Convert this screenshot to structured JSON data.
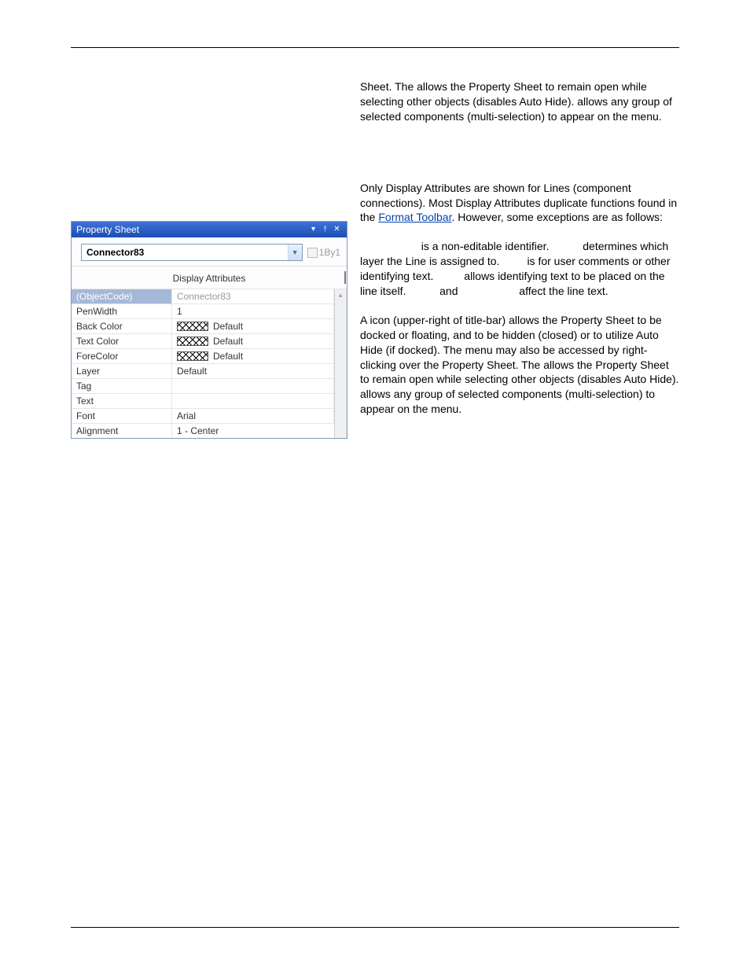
{
  "external_para1": "Sheet. The                       allows the Property Sheet to remain open while selecting other objects (disables Auto Hide).           allows any group of selected components (multi-selection) to appear on the menu.",
  "para_intro_a": "Only Display Attributes are shown for Lines (component connections). Most Display Attributes duplicate functions found in the ",
  "format_toolbar": "Format Toolbar",
  "para_intro_b": ". However, some exceptions are as follows:",
  "bullets": "                    is a non-editable identifier.           determines which layer the Line is assigned to.         is for user comments or other identifying text.          allows identifying text to be placed on the line itself.           and                    affect the line text.",
  "menu_para": "A           icon (upper-right of title-bar) allows the Property Sheet to be docked or floating, and to be hidden (closed) or to utilize Auto Hide (if docked). The menu may also be accessed by right-clicking over the Property Sheet. The                       allows the Property Sheet to remain open while selecting other objects (disables Auto Hide).           allows any group of selected components (multi-selection) to appear on the menu.",
  "panel": {
    "title": "Property Sheet",
    "object": "Connector83",
    "oneby1": "1By1",
    "section": "Display Attributes",
    "rows": [
      {
        "name": "(ObjectCode)",
        "val": "Connector83",
        "sel": true
      },
      {
        "name": "PenWidth",
        "val": "1"
      },
      {
        "name": "Back Color",
        "val": "Default",
        "hatch": true
      },
      {
        "name": "Text Color",
        "val": "Default",
        "hatch": true
      },
      {
        "name": "ForeColor",
        "val": "Default",
        "hatch": true
      },
      {
        "name": "Layer",
        "val": "Default"
      },
      {
        "name": "Tag",
        "val": ""
      },
      {
        "name": "Text",
        "val": ""
      },
      {
        "name": "Font",
        "val": "Arial"
      },
      {
        "name": "Alignment",
        "val": "1 - Center"
      }
    ]
  }
}
